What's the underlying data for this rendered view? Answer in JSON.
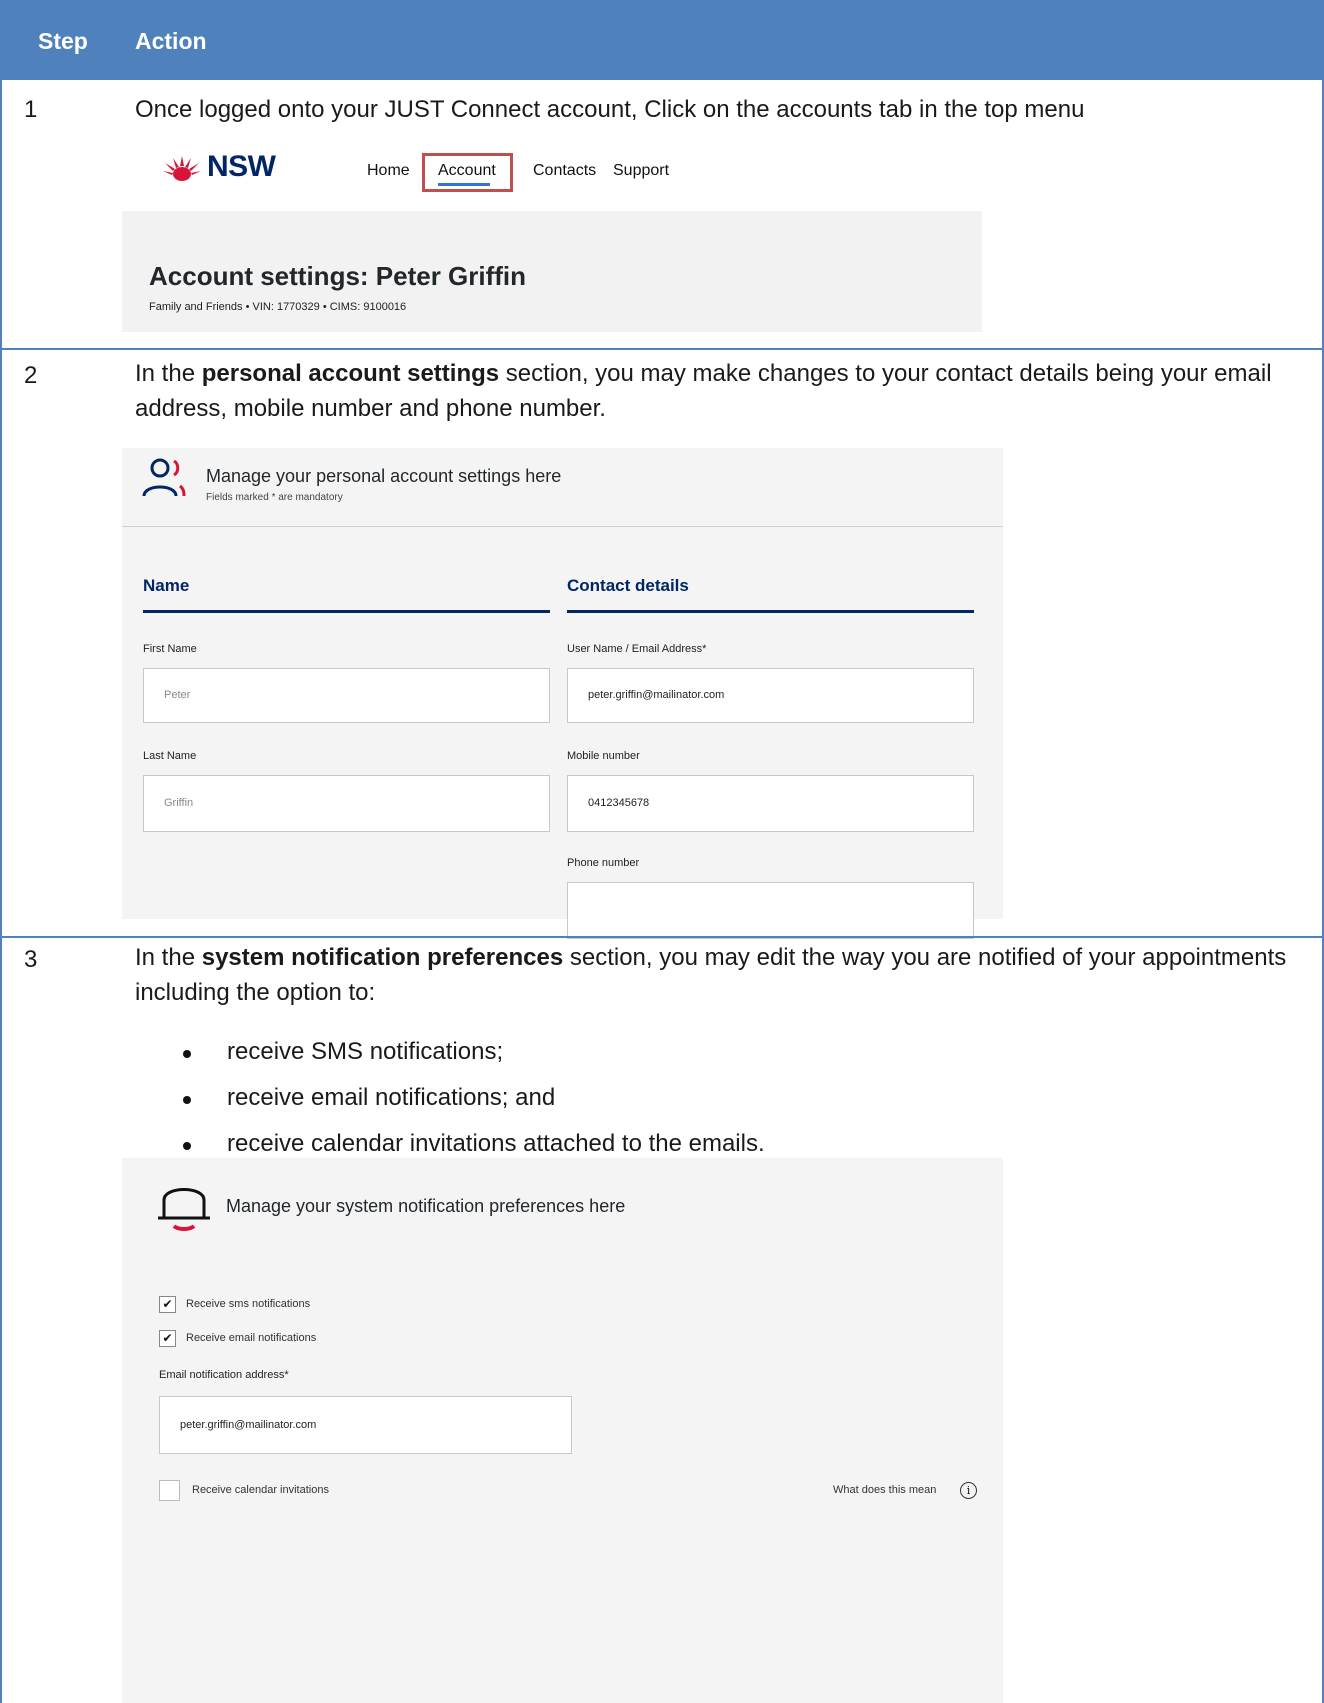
{
  "header": {
    "step": "Step",
    "action": "Action"
  },
  "step1": {
    "number": "1",
    "text": "Once logged onto your JUST Connect account, Click on the accounts tab in the top menu",
    "logo_text": "NSW",
    "nav": [
      "Home",
      "Account",
      "Contacts",
      "Support"
    ],
    "settings_title": "Account settings: Peter Griffin",
    "settings_subtitle": "Family and Friends • VIN: 1770329 • CIMS: 9100016"
  },
  "step2": {
    "number": "2",
    "text_before": "In the ",
    "text_bold": "personal account settings",
    "text_after": " section, you may make changes to your contact details being your email address, mobile number and phone number.",
    "panel_title": "Manage your personal account settings here",
    "panel_subtitle": "Fields marked * are mandatory",
    "name_heading": "Name",
    "contact_heading": "Contact details",
    "first_name_label": "First Name",
    "first_name_value": "Peter",
    "last_name_label": "Last Name",
    "last_name_value": "Griffin",
    "email_label": "User Name / Email Address*",
    "email_value": "peter.griffin@mailinator.com",
    "mobile_label": "Mobile number",
    "mobile_value": "0412345678",
    "phone_label": "Phone number",
    "phone_value": ""
  },
  "step3": {
    "number": "3",
    "text_before": "In the ",
    "text_bold": "system notification preferences",
    "text_after": " section, you may edit the way you are notified of your appointments including the option to:",
    "bullets": [
      "receive SMS notifications;",
      "receive email notifications; and",
      "receive calendar invitations attached to the emails."
    ],
    "panel_title": "Manage your system notification preferences here",
    "sms_label": "Receive sms notifications",
    "sms_checked": true,
    "email_label": "Receive email notifications",
    "email_checked": true,
    "email_address_label": "Email notification address*",
    "email_address_value": "peter.griffin@mailinator.com",
    "calendar_label": "Receive calendar invitations",
    "calendar_checked": false,
    "what_mean": "What does this mean"
  },
  "colors": {
    "header_blue": "#4f81bd",
    "nsw_navy": "#002664",
    "nsw_red": "#d7153a",
    "highlight_box": "#c0504d"
  },
  "icons": [
    "waratah-logo-icon",
    "person-icon",
    "bell-icon",
    "check-icon",
    "info-icon"
  ]
}
